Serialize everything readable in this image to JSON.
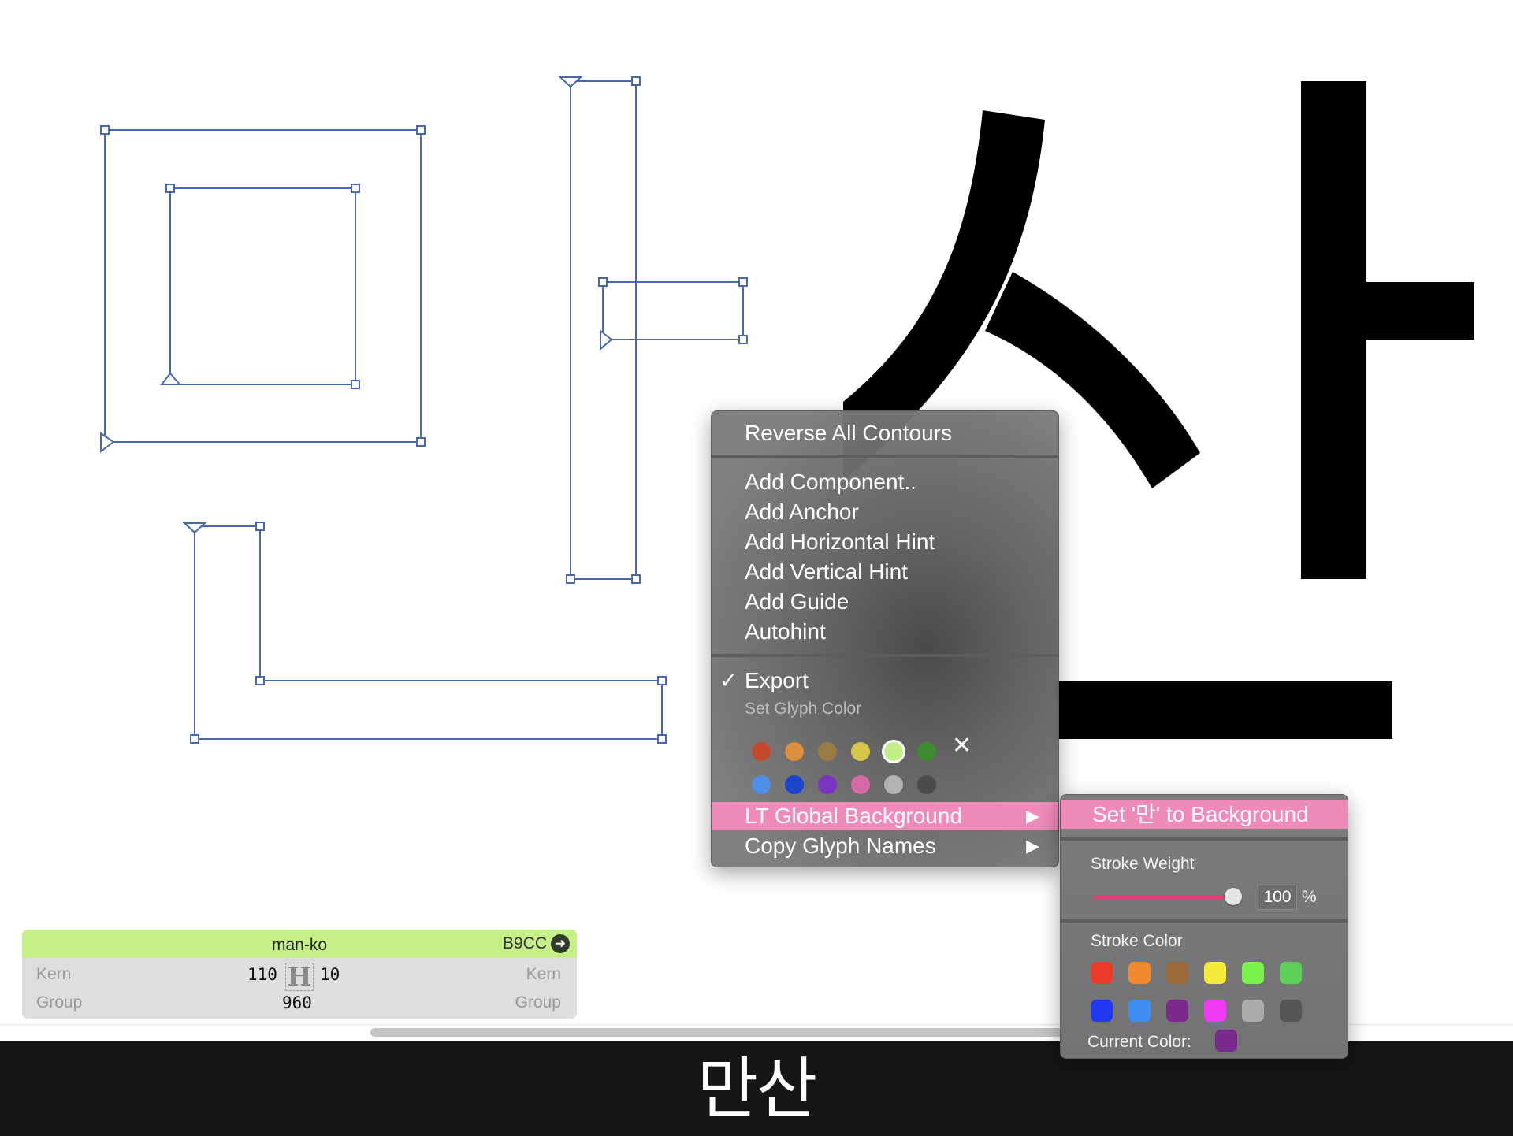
{
  "canvas": {
    "outline_color": "#4668b3",
    "filled_color": "#000000",
    "glyph_right": "산"
  },
  "glyph_info": {
    "name": "man-ko",
    "unicode": "B9CC",
    "go_icon": "arrow-circle-right-icon",
    "left_kern_label": "Kern",
    "right_kern_label": "Kern",
    "left_group_label": "Group",
    "right_group_label": "Group",
    "left_sidebearing": "110",
    "right_sidebearing": "10",
    "width": "960",
    "sample_letter": "H",
    "header_color": "#c6ef87"
  },
  "context_menu": {
    "reverse": "Reverse All Contours",
    "add_component": "Add Component..",
    "add_anchor": "Add Anchor",
    "add_hhint": "Add Horizontal Hint",
    "add_vhint": "Add Vertical Hint",
    "add_guide": "Add Guide",
    "autohint": "Autohint",
    "export": "Export",
    "export_check": "✓",
    "set_glyph_color": "Set Glyph Color",
    "lt_global_background": "LT Global Background",
    "copy_glyph_names": "Copy Glyph Names",
    "submenu_arrow": "▶",
    "clear_icon": "✕",
    "glyph_colors_row1": [
      "#c4492c",
      "#dd8f40",
      "#9a7a45",
      "#d7c64a",
      "#c2ef88",
      "#3f8b30"
    ],
    "glyph_colors_row2": [
      "#4d8ee6",
      "#1b46cc",
      "#7a35c0",
      "#d96aa8",
      "#b3b3b3",
      "#4a4a4a"
    ],
    "selected_color_index": 4,
    "highlight_color": "#ee8bb9"
  },
  "submenu": {
    "set_background": "Set '만' to Background",
    "stroke_weight_label": "Stroke Weight",
    "stroke_weight_value": "100",
    "stroke_weight_unit": "%",
    "stroke_weight_fraction": 1.0,
    "stroke_color_label": "Stroke Color",
    "stroke_colors_row1": [
      "#ea3b2a",
      "#f2892e",
      "#9a6a3a",
      "#f5ea3a",
      "#78f24a",
      "#5ed05a"
    ],
    "stroke_colors_row2": [
      "#1f38f0",
      "#3f8ff2",
      "#7a2a8a",
      "#ee3af2",
      "#ababab",
      "#555555"
    ],
    "current_color_label": "Current Color:",
    "current_color": "#7a2a8a"
  },
  "preview": {
    "text": "만산"
  }
}
